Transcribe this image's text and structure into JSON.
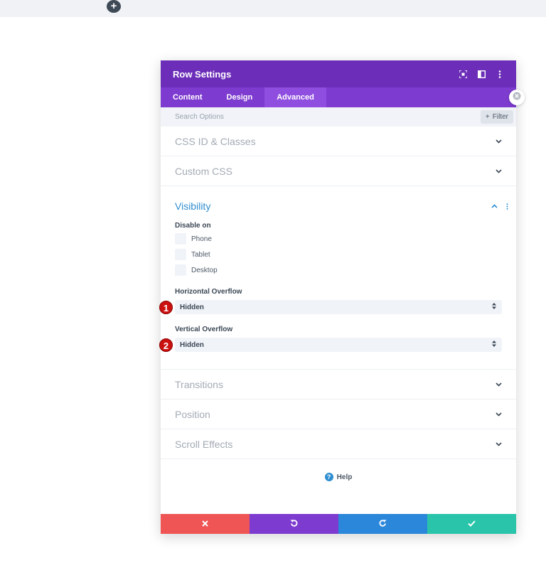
{
  "top": {
    "add_icon": "plus-icon",
    "add_glyph": "+"
  },
  "modal": {
    "title": "Row Settings",
    "header_icons": [
      "fullscreen-icon",
      "sidebar-layout-icon",
      "more-vertical-icon"
    ],
    "tabs": [
      {
        "label": "Content",
        "active": false
      },
      {
        "label": "Design",
        "active": false
      },
      {
        "label": "Advanced",
        "active": true
      }
    ],
    "search": {
      "placeholder": "Search Options",
      "filter_label": "Filter",
      "filter_glyph": "+"
    },
    "sections_top": [
      {
        "title": "CSS ID & Classes"
      },
      {
        "title": "Custom CSS"
      }
    ],
    "visibility": {
      "title": "Visibility",
      "disable_on_label": "Disable on",
      "devices": [
        "Phone",
        "Tablet",
        "Desktop"
      ],
      "horizontal_overflow": {
        "label": "Horizontal Overflow",
        "value": "Hidden",
        "badge": "1"
      },
      "vertical_overflow": {
        "label": "Vertical Overflow",
        "value": "Hidden",
        "badge": "2"
      }
    },
    "sections_bottom": [
      {
        "title": "Transitions"
      },
      {
        "title": "Position"
      },
      {
        "title": "Scroll Effects"
      }
    ],
    "help": {
      "label": "Help",
      "glyph": "?"
    },
    "footer": {
      "buttons": [
        {
          "name": "cancel",
          "icon": "close-icon",
          "color": "#ef5555"
        },
        {
          "name": "undo",
          "icon": "undo-icon",
          "color": "#7e3bd0"
        },
        {
          "name": "redo",
          "icon": "redo-icon",
          "color": "#2b87da"
        },
        {
          "name": "save",
          "icon": "check-icon",
          "color": "#29c4a9"
        }
      ]
    }
  },
  "colors": {
    "header_bg": "#6c2eb9",
    "tabs_bg": "#7e3bd0",
    "active_tab_bg": "#8f4ee0",
    "accent_blue": "#2e8ed0",
    "badge_red": "#cc1010"
  }
}
